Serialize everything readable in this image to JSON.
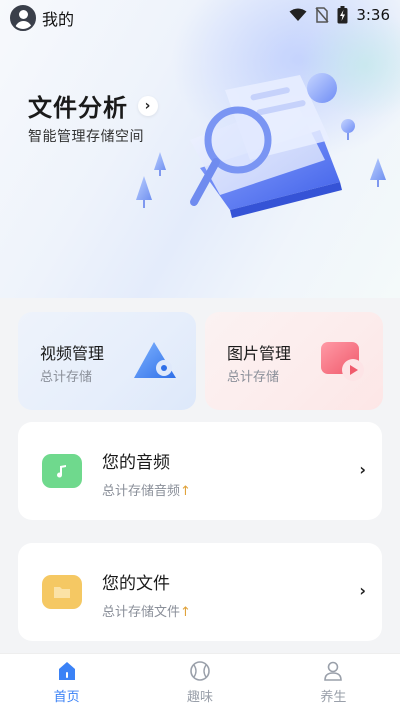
{
  "status_bar": {
    "profile_label": "我的",
    "time": "3:36",
    "icons": [
      "wifi-icon",
      "no-sim-icon",
      "battery-charging-icon"
    ]
  },
  "hero": {
    "title": "文件分析",
    "subtitle": "智能管理存储空间",
    "chevron": "›"
  },
  "cards": {
    "video": {
      "title": "视频管理",
      "subtitle": "总计存储"
    },
    "image": {
      "title": "图片管理",
      "subtitle": "总计存储"
    }
  },
  "rows": {
    "audio": {
      "title": "您的音频",
      "subtitle": "总计存储音频",
      "arrow": "↑",
      "chevron": "›",
      "icon": "music-note-icon",
      "color": "#6fd98d"
    },
    "file": {
      "title": "您的文件",
      "subtitle": "总计存储文件",
      "arrow": "↑",
      "chevron": "›",
      "icon": "folder-icon",
      "color": "#f5c863"
    }
  },
  "tabbar": {
    "tabs": [
      {
        "label": "首页",
        "icon": "home-icon",
        "active": true
      },
      {
        "label": "趣味",
        "icon": "baseball-icon",
        "active": false
      },
      {
        "label": "养生",
        "icon": "user-icon",
        "active": false
      }
    ],
    "active_color": "#3b82f6",
    "inactive_color": "#9aa0aa"
  }
}
